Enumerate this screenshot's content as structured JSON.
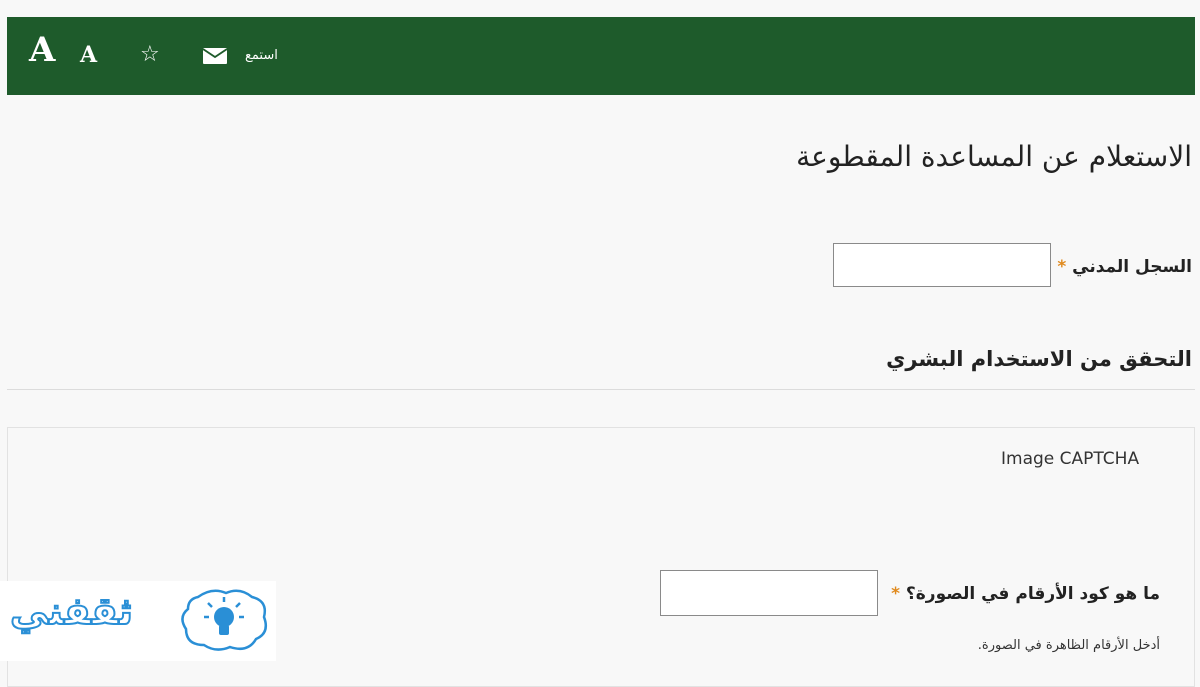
{
  "topbar": {
    "font_large": "A",
    "font_small": "A",
    "listen_label": "استمع",
    "icons": [
      "star-icon",
      "mail-icon"
    ],
    "background_color": "#1e5b2b"
  },
  "page": {
    "title": "الاستعلام عن المساعدة المقطوعة"
  },
  "civil_record": {
    "label": "السجل المدني",
    "required_mark": "*",
    "value": ""
  },
  "human_verification": {
    "title": "التحقق من الاستخدام البشري",
    "captcha_caption": "Image CAPTCHA",
    "question_label": "ما هو كود الأرقام في الصورة؟",
    "required_mark": "*",
    "value": "",
    "hint": "أدخل الأرقام الظاهرة في الصورة."
  },
  "watermark": {
    "text": "ثقفني"
  },
  "colors": {
    "required": "#e08a1e",
    "watermark": "#2a8fd6"
  }
}
